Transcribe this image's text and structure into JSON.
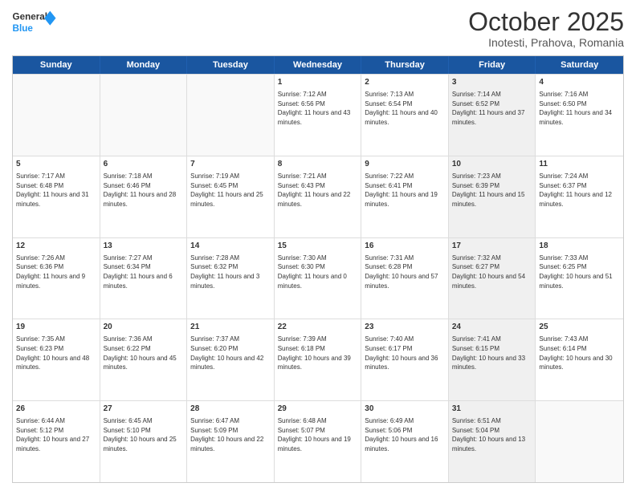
{
  "header": {
    "logo_general": "General",
    "logo_blue": "Blue",
    "month": "October 2025",
    "location": "Inotesti, Prahova, Romania"
  },
  "days_of_week": [
    "Sunday",
    "Monday",
    "Tuesday",
    "Wednesday",
    "Thursday",
    "Friday",
    "Saturday"
  ],
  "rows": [
    [
      {
        "day": "",
        "text": "",
        "shaded": false,
        "empty": true
      },
      {
        "day": "",
        "text": "",
        "shaded": false,
        "empty": true
      },
      {
        "day": "",
        "text": "",
        "shaded": false,
        "empty": true
      },
      {
        "day": "1",
        "text": "Sunrise: 7:12 AM\nSunset: 6:56 PM\nDaylight: 11 hours and 43 minutes.",
        "shaded": false,
        "empty": false
      },
      {
        "day": "2",
        "text": "Sunrise: 7:13 AM\nSunset: 6:54 PM\nDaylight: 11 hours and 40 minutes.",
        "shaded": false,
        "empty": false
      },
      {
        "day": "3",
        "text": "Sunrise: 7:14 AM\nSunset: 6:52 PM\nDaylight: 11 hours and 37 minutes.",
        "shaded": true,
        "empty": false
      },
      {
        "day": "4",
        "text": "Sunrise: 7:16 AM\nSunset: 6:50 PM\nDaylight: 11 hours and 34 minutes.",
        "shaded": false,
        "empty": false
      }
    ],
    [
      {
        "day": "5",
        "text": "Sunrise: 7:17 AM\nSunset: 6:48 PM\nDaylight: 11 hours and 31 minutes.",
        "shaded": false,
        "empty": false
      },
      {
        "day": "6",
        "text": "Sunrise: 7:18 AM\nSunset: 6:46 PM\nDaylight: 11 hours and 28 minutes.",
        "shaded": false,
        "empty": false
      },
      {
        "day": "7",
        "text": "Sunrise: 7:19 AM\nSunset: 6:45 PM\nDaylight: 11 hours and 25 minutes.",
        "shaded": false,
        "empty": false
      },
      {
        "day": "8",
        "text": "Sunrise: 7:21 AM\nSunset: 6:43 PM\nDaylight: 11 hours and 22 minutes.",
        "shaded": false,
        "empty": false
      },
      {
        "day": "9",
        "text": "Sunrise: 7:22 AM\nSunset: 6:41 PM\nDaylight: 11 hours and 19 minutes.",
        "shaded": false,
        "empty": false
      },
      {
        "day": "10",
        "text": "Sunrise: 7:23 AM\nSunset: 6:39 PM\nDaylight: 11 hours and 15 minutes.",
        "shaded": true,
        "empty": false
      },
      {
        "day": "11",
        "text": "Sunrise: 7:24 AM\nSunset: 6:37 PM\nDaylight: 11 hours and 12 minutes.",
        "shaded": false,
        "empty": false
      }
    ],
    [
      {
        "day": "12",
        "text": "Sunrise: 7:26 AM\nSunset: 6:36 PM\nDaylight: 11 hours and 9 minutes.",
        "shaded": false,
        "empty": false
      },
      {
        "day": "13",
        "text": "Sunrise: 7:27 AM\nSunset: 6:34 PM\nDaylight: 11 hours and 6 minutes.",
        "shaded": false,
        "empty": false
      },
      {
        "day": "14",
        "text": "Sunrise: 7:28 AM\nSunset: 6:32 PM\nDaylight: 11 hours and 3 minutes.",
        "shaded": false,
        "empty": false
      },
      {
        "day": "15",
        "text": "Sunrise: 7:30 AM\nSunset: 6:30 PM\nDaylight: 11 hours and 0 minutes.",
        "shaded": false,
        "empty": false
      },
      {
        "day": "16",
        "text": "Sunrise: 7:31 AM\nSunset: 6:28 PM\nDaylight: 10 hours and 57 minutes.",
        "shaded": false,
        "empty": false
      },
      {
        "day": "17",
        "text": "Sunrise: 7:32 AM\nSunset: 6:27 PM\nDaylight: 10 hours and 54 minutes.",
        "shaded": true,
        "empty": false
      },
      {
        "day": "18",
        "text": "Sunrise: 7:33 AM\nSunset: 6:25 PM\nDaylight: 10 hours and 51 minutes.",
        "shaded": false,
        "empty": false
      }
    ],
    [
      {
        "day": "19",
        "text": "Sunrise: 7:35 AM\nSunset: 6:23 PM\nDaylight: 10 hours and 48 minutes.",
        "shaded": false,
        "empty": false
      },
      {
        "day": "20",
        "text": "Sunrise: 7:36 AM\nSunset: 6:22 PM\nDaylight: 10 hours and 45 minutes.",
        "shaded": false,
        "empty": false
      },
      {
        "day": "21",
        "text": "Sunrise: 7:37 AM\nSunset: 6:20 PM\nDaylight: 10 hours and 42 minutes.",
        "shaded": false,
        "empty": false
      },
      {
        "day": "22",
        "text": "Sunrise: 7:39 AM\nSunset: 6:18 PM\nDaylight: 10 hours and 39 minutes.",
        "shaded": false,
        "empty": false
      },
      {
        "day": "23",
        "text": "Sunrise: 7:40 AM\nSunset: 6:17 PM\nDaylight: 10 hours and 36 minutes.",
        "shaded": false,
        "empty": false
      },
      {
        "day": "24",
        "text": "Sunrise: 7:41 AM\nSunset: 6:15 PM\nDaylight: 10 hours and 33 minutes.",
        "shaded": true,
        "empty": false
      },
      {
        "day": "25",
        "text": "Sunrise: 7:43 AM\nSunset: 6:14 PM\nDaylight: 10 hours and 30 minutes.",
        "shaded": false,
        "empty": false
      }
    ],
    [
      {
        "day": "26",
        "text": "Sunrise: 6:44 AM\nSunset: 5:12 PM\nDaylight: 10 hours and 27 minutes.",
        "shaded": false,
        "empty": false
      },
      {
        "day": "27",
        "text": "Sunrise: 6:45 AM\nSunset: 5:10 PM\nDaylight: 10 hours and 25 minutes.",
        "shaded": false,
        "empty": false
      },
      {
        "day": "28",
        "text": "Sunrise: 6:47 AM\nSunset: 5:09 PM\nDaylight: 10 hours and 22 minutes.",
        "shaded": false,
        "empty": false
      },
      {
        "day": "29",
        "text": "Sunrise: 6:48 AM\nSunset: 5:07 PM\nDaylight: 10 hours and 19 minutes.",
        "shaded": false,
        "empty": false
      },
      {
        "day": "30",
        "text": "Sunrise: 6:49 AM\nSunset: 5:06 PM\nDaylight: 10 hours and 16 minutes.",
        "shaded": false,
        "empty": false
      },
      {
        "day": "31",
        "text": "Sunrise: 6:51 AM\nSunset: 5:04 PM\nDaylight: 10 hours and 13 minutes.",
        "shaded": true,
        "empty": false
      },
      {
        "day": "",
        "text": "",
        "shaded": false,
        "empty": true
      }
    ]
  ]
}
